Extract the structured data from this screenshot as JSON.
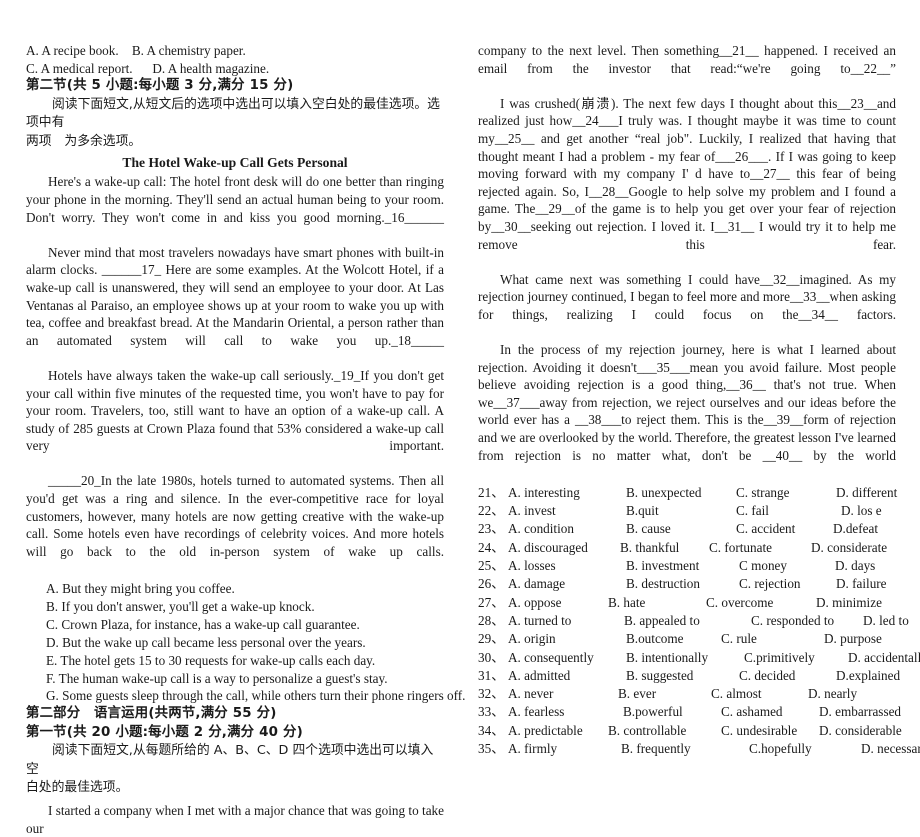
{
  "left_column": {
    "reading_answer_options": [
      "A. A recipe book. B. A chemistry paper.",
      "C. A medical report.  D. A health magazine."
    ],
    "section_heading": "第二节(共 5 小题:每小题 3 分,满分 15 分)",
    "section_instruction_line1": "阅读下面短文,从短文后的选项中选出可以填入空白处的最佳选项。选项中有",
    "section_instruction_line2": "两项 为多余选项。",
    "article_title": "The Hotel Wake-up Call Gets Personal",
    "article_paragraphs": [
      "Here's a wake-up call: The hotel front desk will do one better than ringing your phone in the morning. They'll send an actual human being to your room. Don't worry. They won't come in and kiss you good morning._16______",
      "Never mind that most travelers nowadays have smart phones with built-in alarm clocks. ______17_  Here are some examples. At the Wolcott Hotel, if a wake-up call is unanswered, they will send an employee to your door. At Las Ventanas al Paraiso, an employee shows up at your room to wake you up with tea, coffee and breakfast bread. At the Mandarin Oriental, a person rather than an automated system will call to wake you up._18_____",
      "Hotels have always taken the wake-up call seriously._19_If you don't get your call within five minutes of the requested time, you won't have to pay for your room. Travelers, too, still want to have an option of a wake-up call. A study of 285 guests at Crown Plaza found that 53%   considered a wake-up call very important.",
      "_____20_In the late 1980s, hotels turned to automated systems. Then all you'd get was a ring and silence. In the ever-competitive race for loyal customers, however, many hotels are now getting creative with the wake-up call. Some hotels even have recordings of celebrity voices. And more hotels will go back to the old in-person system of wake up calls."
    ],
    "option_list": [
      "A. But they might bring you coffee.",
      "B. If you don't answer, you'll get a wake-up knock.",
      "C. Crown Plaza, for instance, has a wake-up call guarantee.",
      "D. But the wake up call became less personal over the years.",
      "E. The hotel gets 15 to 30 requests for wake-up calls each day.",
      "F. The human wake-up call is a way to personalize a guest's stay.",
      "G. Some guests sleep through the call, while others turn their phone ringers off."
    ],
    "part_two_heading": "第二部分 语言运用(共两节,满分 55 分)",
    "part_two_section_heading": "第一节(共 20 小题:每小题 2 分,满分 40 分)",
    "part_two_instruction_line1": "阅读下面短文,从每题所给的 A、B、C、D 四个选项中选出可以填入空",
    "part_two_instruction_line2": "白处的最佳选项。",
    "cloze_first_line": "I started a company when I met with a major chance that was going to take our"
  },
  "right_column": {
    "cloze_paragraphs": [
      "company to the next level. Then something__21__ happened. I received an email from the investor that read:“we're going to__22__”",
      "I was crushed(崩溃). The next few days I thought about this__23__and realized just how__24___I truly was. I thought maybe it was time to count my__25__ and get another “real job\". Luckily, I realized that having that thought meant I had a problem - my fear of___26___. If I was going to keep moving forward with my company I' d have to__27__ this fear of being rejected again. So, I__28__Google to help solve my problem and I found a game. The__29__of the game is to help you get over your fear of rejection by__30__seeking out rejection. I loved it. I__31__  I would try it to help me remove this fear.",
      "What came next was something I could have__32__imagined. As my rejection journey continued, I began to feel more and more__33__when asking for things, realizing I could focus on the__34__ factors.",
      "In the process of my rejection journey, here is what I learned about rejection. Avoiding it doesn't___35___mean you avoid failure. Most people believe avoiding rejection is a good thing,__36__ that's not true. When we__37___away from rejection, we reject ourselves and our ideas before the world ever has a __38___to reject them. This is the__39__form of rejection and we are overlooked by the world. Therefore, the greatest lesson I've learned from rejection is no matter what, don't be __40__ by the world"
    ],
    "questions": [
      {
        "num": "21、",
        "options": [
          "A. interesting",
          "B. unexpected",
          "C. strange",
          "D. different"
        ],
        "widths": [
          118,
          110,
          100,
          0
        ]
      },
      {
        "num": "22、",
        "options": [
          "A. invest",
          "B.quit",
          "C. fail",
          "D. los    e"
        ],
        "widths": [
          118,
          110,
          105,
          0
        ]
      },
      {
        "num": "23、",
        "options": [
          "A. condition",
          "B. cause",
          "C. accident",
          "D.defeat"
        ],
        "widths": [
          118,
          110,
          97,
          0
        ]
      },
      {
        "num": "24、",
        "options": [
          "A. discouraged",
          "B. thankful",
          "C. fortunate",
          "D. considerate"
        ],
        "widths": [
          112,
          89,
          102,
          0
        ]
      },
      {
        "num": "25、",
        "options": [
          "A. losses",
          "B. investment",
          "C money",
          "D. days"
        ],
        "widths": [
          118,
          113,
          96,
          0
        ]
      },
      {
        "num": "26、",
        "options": [
          "A. damage",
          "B. destruction",
          "C. rejection",
          "D. failure"
        ],
        "widths": [
          118,
          113,
          97,
          0
        ]
      },
      {
        "num": "27、",
        "options": [
          "A. oppose",
          "B. hate",
          "C. overcome",
          "D. minimize"
        ],
        "widths": [
          100,
          98,
          110,
          0
        ]
      },
      {
        "num": "28、",
        "options": [
          "A. turned to",
          "B. appealed to",
          "C. responded to",
          "D. led to"
        ],
        "widths": [
          116,
          127,
          112,
          0
        ]
      },
      {
        "num": "29、",
        "options": [
          "A. origin",
          "B.outcome",
          "C. rule",
          "D. purpose"
        ],
        "widths": [
          118,
          95,
          103,
          0
        ]
      },
      {
        "num": "30、",
        "options": [
          "A. consequently",
          "B. intentionally",
          "C.primitively",
          "D. accidentally"
        ],
        "widths": [
          118,
          118,
          104,
          0
        ]
      },
      {
        "num": "31、",
        "options": [
          "A. admitted",
          "B. suggested",
          "C. decided",
          "D.explained"
        ],
        "widths": [
          118,
          113,
          97,
          0
        ]
      },
      {
        "num": "32、",
        "options": [
          "A. never",
          "B. ever",
          "C. almost",
          "D. nearly"
        ],
        "widths": [
          110,
          93,
          97,
          0
        ]
      },
      {
        "num": "33、",
        "options": [
          "A. fearless",
          "B.powerful",
          "C. ashamed",
          "D. embarrassed"
        ],
        "widths": [
          115,
          98,
          98,
          0
        ]
      },
      {
        "num": "34、",
        "options": [
          "A. predictable",
          "B. controllable",
          "C. undesirable",
          "D. considerable"
        ],
        "widths": [
          100,
          113,
          98,
          0
        ]
      },
      {
        "num": "35、",
        "options": [
          "A. firmly",
          "B. frequently",
          "C.hopefully",
          "D. necessarily"
        ],
        "widths": [
          113,
          128,
          112,
          0
        ]
      }
    ]
  }
}
